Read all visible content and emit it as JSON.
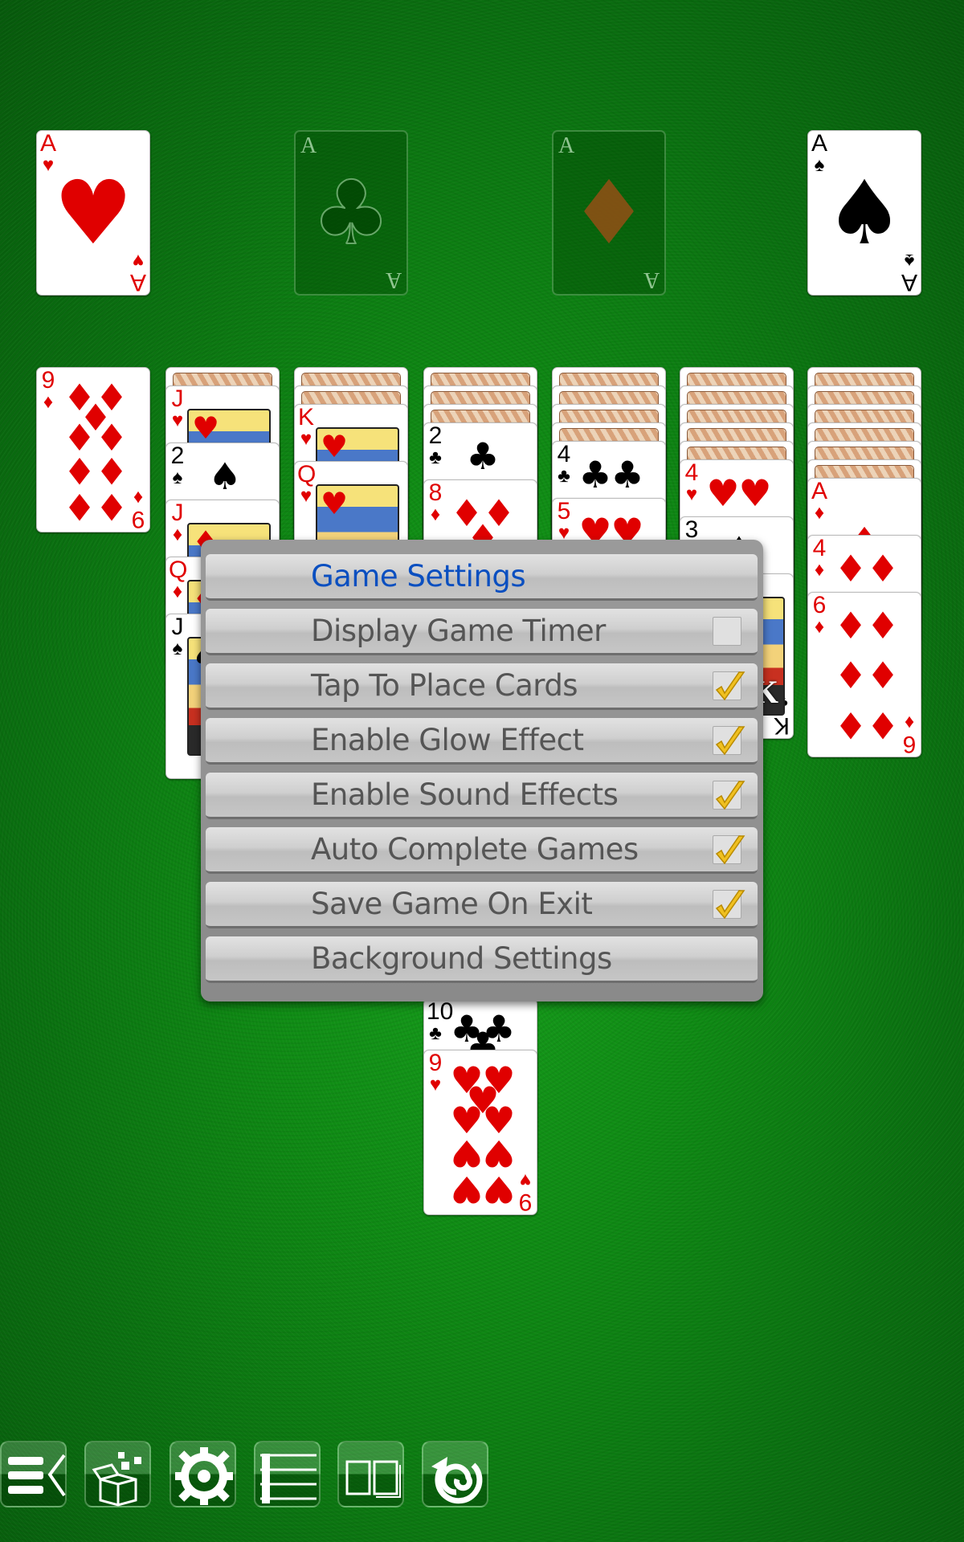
{
  "foundations": [
    {
      "type": "card",
      "rank": "A",
      "suit": "hearts"
    },
    {
      "type": "empty_slot",
      "label": "A",
      "suit": "clubs"
    },
    {
      "type": "empty_slot",
      "label": "A",
      "suit": "diamonds"
    },
    {
      "type": "card",
      "rank": "A",
      "suit": "spades"
    }
  ],
  "tableau": [
    [
      {
        "rank": "9",
        "suit": "diamonds",
        "up": true
      }
    ],
    [
      {
        "up": false
      },
      {
        "rank": "J",
        "suit": "hearts",
        "up": true
      },
      {
        "rank": "2",
        "suit": "spades",
        "up": true
      },
      {
        "rank": "J",
        "suit": "diamonds",
        "up": true
      },
      {
        "rank": "Q",
        "suit": "diamonds",
        "up": true
      },
      {
        "rank": "J",
        "suit": "spades",
        "up": true
      }
    ],
    [
      {
        "up": false
      },
      {
        "up": false
      },
      {
        "rank": "K",
        "suit": "hearts",
        "up": true
      },
      {
        "rank": "Q",
        "suit": "hearts",
        "up": true
      }
    ],
    [
      {
        "up": false
      },
      {
        "up": false
      },
      {
        "up": false
      },
      {
        "rank": "2",
        "suit": "clubs",
        "up": true
      },
      {
        "rank": "8",
        "suit": "diamonds",
        "up": true
      },
      {
        "rank": "10",
        "suit": "clubs",
        "up": true
      },
      {
        "rank": "9",
        "suit": "hearts",
        "up": true
      }
    ],
    [
      {
        "up": false
      },
      {
        "up": false
      },
      {
        "up": false
      },
      {
        "up": false
      },
      {
        "rank": "4",
        "suit": "clubs",
        "up": true
      },
      {
        "rank": "5",
        "suit": "hearts",
        "up": true
      }
    ],
    [
      {
        "up": false
      },
      {
        "up": false
      },
      {
        "up": false
      },
      {
        "up": false
      },
      {
        "up": false
      },
      {
        "rank": "4",
        "suit": "hearts",
        "up": true
      },
      {
        "rank": "3",
        "suit": "spades",
        "up": true
      },
      {
        "rank": "K",
        "suit": "clubs",
        "up": true
      }
    ],
    [
      {
        "up": false
      },
      {
        "up": false
      },
      {
        "up": false
      },
      {
        "up": false
      },
      {
        "up": false
      },
      {
        "up": false
      },
      {
        "rank": "A",
        "suit": "diamonds",
        "up": true
      },
      {
        "rank": "4",
        "suit": "diamonds",
        "up": true
      },
      {
        "rank": "6",
        "suit": "diamonds",
        "up": true
      }
    ]
  ],
  "dialog": {
    "title": "Game Settings",
    "title_color": "#0a4fc0",
    "options": [
      {
        "label": "Display Game Timer",
        "checked": false
      },
      {
        "label": "Tap To Place Cards",
        "checked": true
      },
      {
        "label": "Enable Glow Effect",
        "checked": true
      },
      {
        "label": "Enable Sound Effects",
        "checked": true
      },
      {
        "label": "Auto Complete Games",
        "checked": true
      },
      {
        "label": "Save Game On Exit",
        "checked": true
      }
    ],
    "background_settings": "Background Settings"
  },
  "toolbar": [
    {
      "icon": "menu-icon"
    },
    {
      "icon": "new-game-box-icon"
    },
    {
      "icon": "gear-icon"
    },
    {
      "icon": "list-icon"
    },
    {
      "icon": "cards-icon"
    },
    {
      "icon": "undo-spiral-icon"
    }
  ],
  "colors": {
    "felt": "#0f8a14",
    "red_suit": "#e00000",
    "check": "#f0c020"
  }
}
